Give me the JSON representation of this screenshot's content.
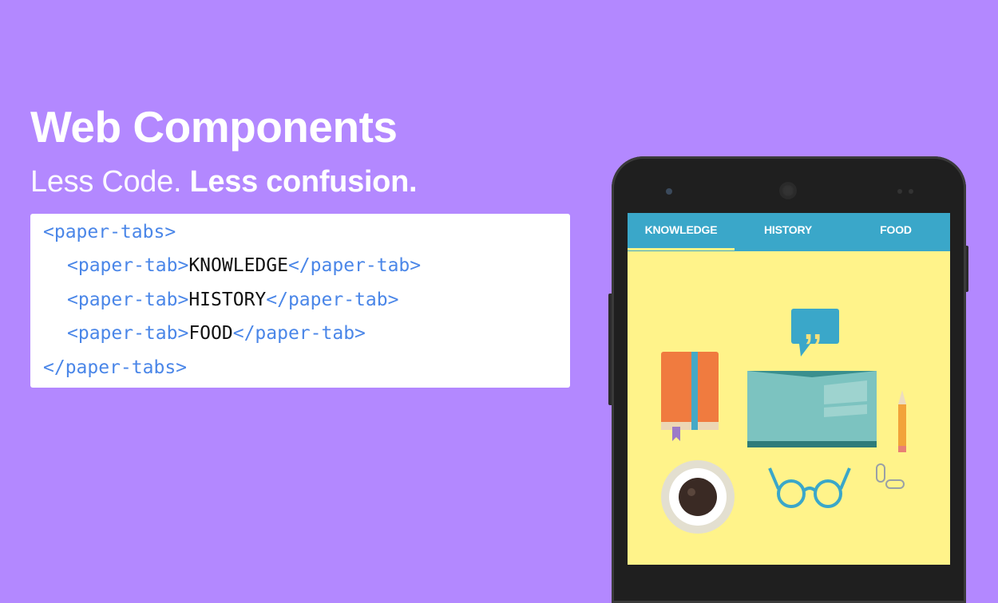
{
  "header": {
    "title": "Web Components",
    "subtitle_light": "Less Code.",
    "subtitle_bold": "Less confusion."
  },
  "code": {
    "open_tabs": "<paper-tabs>",
    "open_tab": "<paper-tab>",
    "close_tab": "</paper-tab>",
    "close_tabs": "</paper-tabs>",
    "items": [
      "KNOWLEDGE",
      "HISTORY",
      "FOOD"
    ]
  },
  "phone": {
    "tabs": [
      "KNOWLEDGE",
      "HISTORY",
      "FOOD"
    ],
    "selected_tab": "KNOWLEDGE"
  },
  "colors": {
    "background": "#b388ff",
    "tag": "#4a86e8",
    "tab_bar": "#3aa7c9",
    "screen": "#fff38a"
  },
  "icons": [
    "book-icon",
    "quote-bubble-icon",
    "open-book-icon",
    "pencil-icon",
    "coffee-cup-icon",
    "glasses-icon",
    "paperclip-icon"
  ]
}
